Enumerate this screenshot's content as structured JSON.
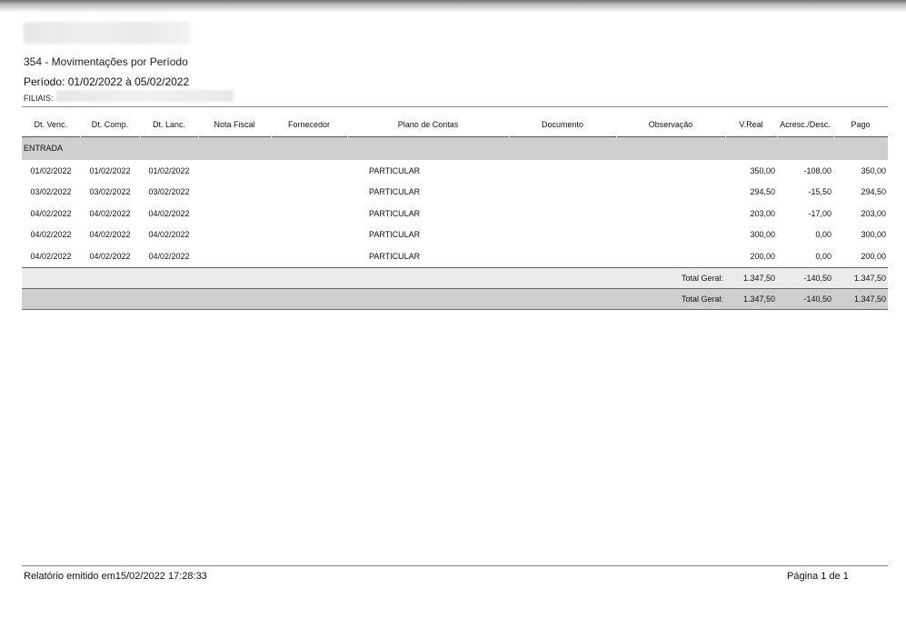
{
  "report": {
    "title": "354 - Movimentações por Período",
    "period": "Período: 01/02/2022 à 05/02/2022",
    "filiais_label": "FILIAIS:"
  },
  "table": {
    "headers": [
      "Dt. Venc.",
      "Dt. Comp.",
      "Dt. Lanc.",
      "Nota Fiscal",
      "Fornecedor",
      "Plano de Contas",
      "Documento",
      "Observação",
      "V.Real",
      "Acresc./Desc.",
      "Pago"
    ],
    "section": "ENTRADA",
    "rows": [
      {
        "venc": "01/02/2022",
        "comp": "01/02/2022",
        "lanc": "01/02/2022",
        "nota": "",
        "fornecedor": "",
        "plano": "PARTICULAR",
        "documento": "",
        "obs": "",
        "vreal": "350,00",
        "acresc": "-108,00",
        "pago": "350,00"
      },
      {
        "venc": "03/02/2022",
        "comp": "03/02/2022",
        "lanc": "03/02/2022",
        "nota": "",
        "fornecedor": "",
        "plano": "PARTICULAR",
        "documento": "",
        "obs": "",
        "vreal": "294,50",
        "acresc": "-15,50",
        "pago": "294,50"
      },
      {
        "venc": "04/02/2022",
        "comp": "04/02/2022",
        "lanc": "04/02/2022",
        "nota": "",
        "fornecedor": "",
        "plano": "PARTICULAR",
        "documento": "",
        "obs": "",
        "vreal": "203,00",
        "acresc": "-17,00",
        "pago": "203,00"
      },
      {
        "venc": "04/02/2022",
        "comp": "04/02/2022",
        "lanc": "04/02/2022",
        "nota": "",
        "fornecedor": "",
        "plano": "PARTICULAR",
        "documento": "",
        "obs": "",
        "vreal": "300,00",
        "acresc": "0,00",
        "pago": "300,00"
      },
      {
        "venc": "04/02/2022",
        "comp": "04/02/2022",
        "lanc": "04/02/2022",
        "nota": "",
        "fornecedor": "",
        "plano": "PARTICULAR",
        "documento": "",
        "obs": "",
        "vreal": "200,00",
        "acresc": "0,00",
        "pago": "200,00"
      }
    ],
    "section_total": {
      "label": "Total Geral:",
      "vreal": "1.347,50",
      "acresc": "-140,50",
      "pago": "1.347,50"
    },
    "grand_total": {
      "label": "Total Geral:",
      "vreal": "1.347,50",
      "acresc": "-140,50",
      "pago": "1.347,50"
    }
  },
  "footer": {
    "emitted": "Relatório emitido em15/02/2022 17:28:33",
    "page": "Página 1 de 1"
  }
}
